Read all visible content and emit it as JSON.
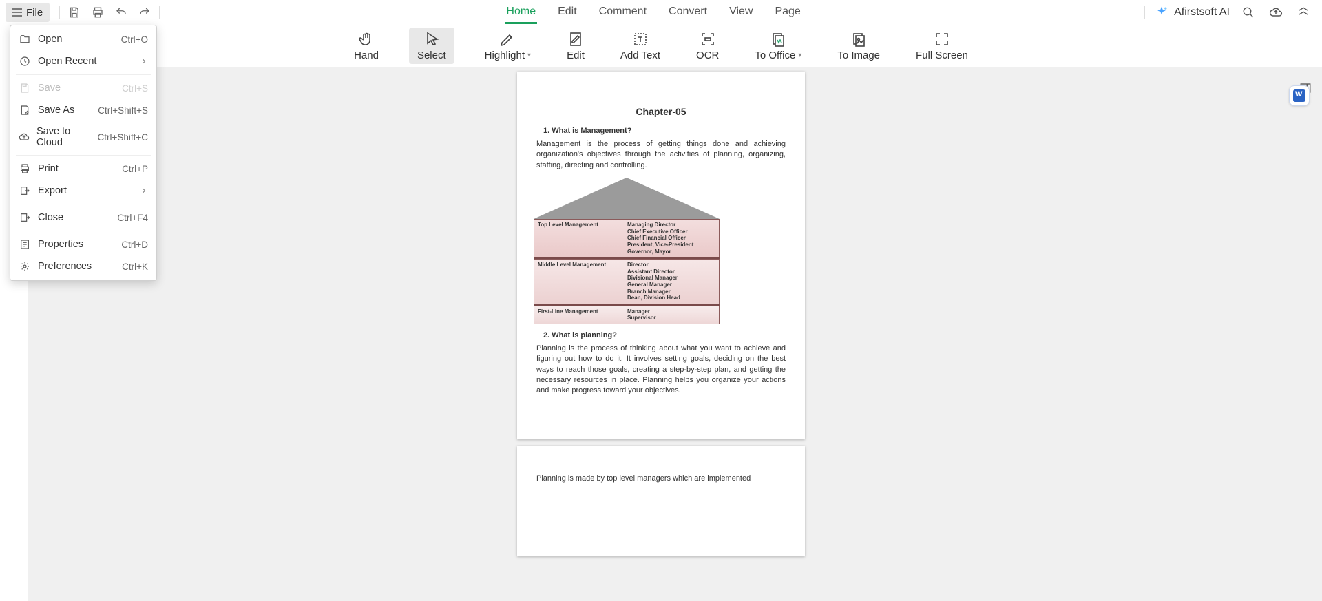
{
  "topbar": {
    "file_label": "File",
    "tabs": [
      "Home",
      "Edit",
      "Comment",
      "Convert",
      "View",
      "Page"
    ],
    "active_tab_index": 0,
    "ai_label": "Afirstsoft AI"
  },
  "ribbon": {
    "items": [
      {
        "label": "Hand"
      },
      {
        "label": "Select"
      },
      {
        "label": "Highlight",
        "dropdown": true
      },
      {
        "label": "Edit"
      },
      {
        "label": "Add Text"
      },
      {
        "label": "OCR"
      },
      {
        "label": "To Office",
        "dropdown": true
      },
      {
        "label": "To Image"
      },
      {
        "label": "Full Screen"
      }
    ],
    "selected_index": 1
  },
  "file_menu": {
    "items": [
      {
        "label": "Open",
        "shortcut": "Ctrl+O",
        "icon": "open"
      },
      {
        "label": "Open Recent",
        "submenu": true,
        "icon": "recent"
      },
      {
        "label": "Save",
        "shortcut": "Ctrl+S",
        "icon": "save",
        "disabled": true
      },
      {
        "label": "Save As",
        "shortcut": "Ctrl+Shift+S",
        "icon": "saveas"
      },
      {
        "label": "Save to Cloud",
        "shortcut": "Ctrl+Shift+C",
        "icon": "cloud"
      },
      {
        "label": "Print",
        "shortcut": "Ctrl+P",
        "icon": "print"
      },
      {
        "label": "Export",
        "submenu": true,
        "icon": "export"
      },
      {
        "label": "Close",
        "shortcut": "Ctrl+F4",
        "icon": "close"
      },
      {
        "label": "Properties",
        "shortcut": "Ctrl+D",
        "icon": "props"
      },
      {
        "label": "Preferences",
        "shortcut": "Ctrl+K",
        "icon": "prefs"
      }
    ],
    "separators_after": [
      1,
      4,
      6,
      7
    ]
  },
  "document": {
    "chapter_title": "Chapter-05",
    "q1": "1. What is Management?",
    "p1": "Management is the process of getting things done and achieving organization's objectives through the activities of planning, organizing, staffing, directing and controlling.",
    "pyramid": {
      "levels": [
        {
          "label": "Top Level Management",
          "values": [
            "Managing Director",
            "Chief Executive Officer",
            "Chief Financial Officer",
            "President, Vice-President",
            "Governor, Mayor"
          ]
        },
        {
          "label": "Middle Level Management",
          "values": [
            "Director",
            "Assistant Director",
            "Divisional Manager",
            "General Manager",
            "Branch Manager",
            "Dean, Division Head"
          ]
        },
        {
          "label": "First-Line Management",
          "values": [
            "Manager",
            "Supervisor"
          ]
        }
      ]
    },
    "q2": "2. What is planning?",
    "p2": "Planning is the process of thinking about what you want to achieve and figuring out how to do it. It involves setting goals, deciding on the best ways to reach those goals, creating a step-by-step plan, and getting the necessary resources in place. Planning helps you organize your actions and make progress toward your objectives.",
    "p3": "Planning is made by top level managers which are implemented"
  }
}
